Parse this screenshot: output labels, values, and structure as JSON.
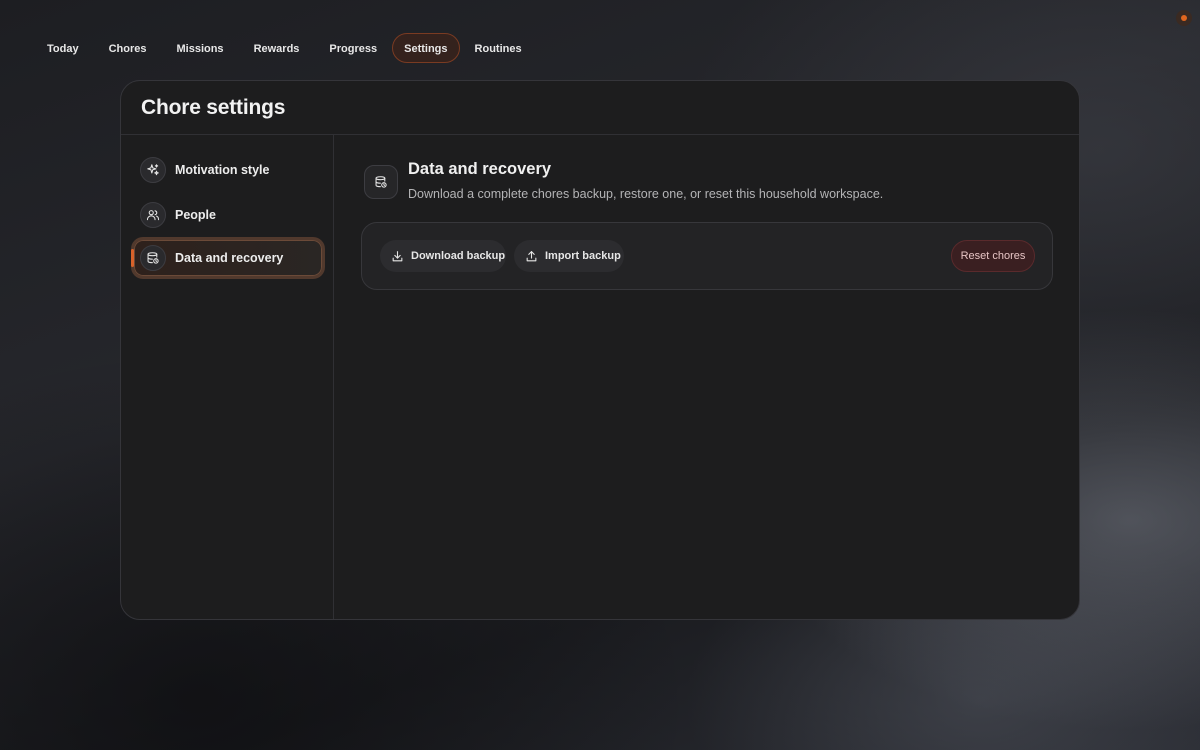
{
  "nav": {
    "items": [
      {
        "label": "Today",
        "active": false
      },
      {
        "label": "Chores",
        "active": false
      },
      {
        "label": "Missions",
        "active": false
      },
      {
        "label": "Rewards",
        "active": false
      },
      {
        "label": "Progress",
        "active": false
      },
      {
        "label": "Settings",
        "active": true
      },
      {
        "label": "Routines",
        "active": false
      }
    ]
  },
  "status": {
    "icon": "status-dot-icon",
    "color": "#e0661f"
  },
  "card": {
    "title": "Chore settings"
  },
  "sidebar": {
    "items": [
      {
        "label": "Motivation style",
        "icon": "sparkles-icon",
        "active": false
      },
      {
        "label": "People",
        "icon": "people-icon",
        "active": false
      },
      {
        "label": "Data and recovery",
        "icon": "database-restore-icon",
        "active": true
      }
    ]
  },
  "section": {
    "icon": "database-restore-icon",
    "title": "Data and recovery",
    "description": "Download a complete chores backup, restore one, or reset this household workspace."
  },
  "actions": {
    "download_label": "Download backup",
    "download_icon": "download-icon",
    "import_label": "Import backup",
    "import_icon": "upload-icon",
    "reset_label": "Reset chores"
  },
  "colors": {
    "accent": "#d9622a",
    "danger_bg": "#3a1f21"
  }
}
